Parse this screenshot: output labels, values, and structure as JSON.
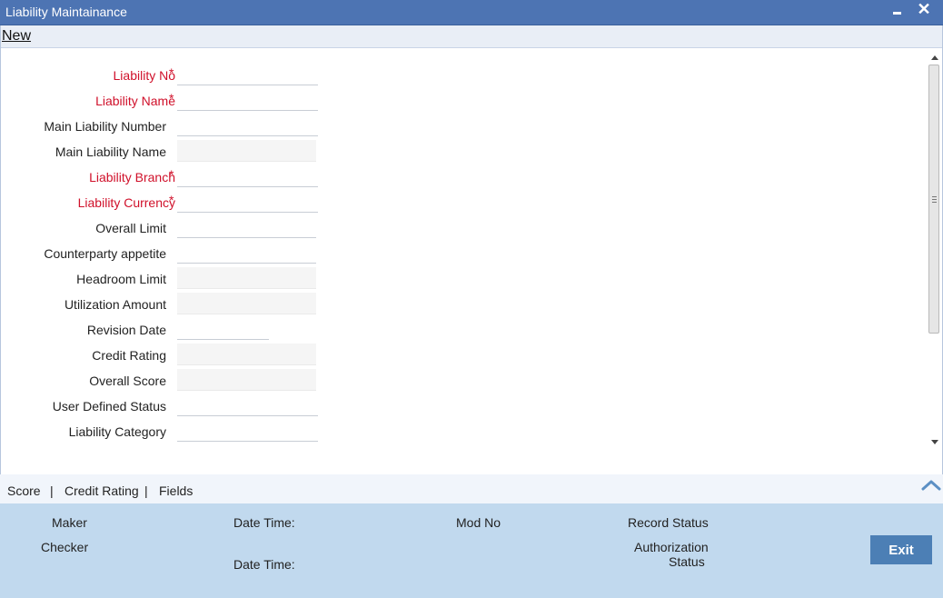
{
  "window": {
    "title": "Liability Maintainance",
    "minimize_icon": "minimize-icon",
    "close_icon": "close-icon",
    "close_glyph": "✕"
  },
  "toolbar": {
    "new_label": "New"
  },
  "form": {
    "fields": [
      {
        "label": "Liability No",
        "required": true,
        "value": "",
        "readonly": false
      },
      {
        "label": "Liability Name",
        "required": true,
        "value": "",
        "readonly": false
      },
      {
        "label": "Main Liability Number",
        "required": false,
        "value": "",
        "readonly": false
      },
      {
        "label": "Main Liability Name",
        "required": false,
        "value": "",
        "readonly": true
      },
      {
        "label": "Liability Branch",
        "required": true,
        "value": "",
        "readonly": false
      },
      {
        "label": "Liability Currency",
        "required": true,
        "value": "",
        "readonly": false
      },
      {
        "label": "Overall Limit",
        "required": false,
        "value": "",
        "readonly": false
      },
      {
        "label": "Counterparty appetite",
        "required": false,
        "value": "",
        "readonly": false
      },
      {
        "label": "Headroom Limit",
        "required": false,
        "value": "",
        "readonly": true
      },
      {
        "label": "Utilization Amount",
        "required": false,
        "value": "",
        "readonly": true
      },
      {
        "label": "Revision Date",
        "required": false,
        "value": "",
        "readonly": false
      },
      {
        "label": "Credit Rating",
        "required": false,
        "value": "",
        "readonly": true
      },
      {
        "label": "Overall Score",
        "required": false,
        "value": "",
        "readonly": true
      },
      {
        "label": "User Defined Status",
        "required": false,
        "value": "",
        "readonly": false
      },
      {
        "label": "Liability Category",
        "required": false,
        "value": "",
        "readonly": false
      }
    ],
    "required_marker": "*"
  },
  "tabs": [
    {
      "label": "Score"
    },
    {
      "label": "Credit Rating"
    },
    {
      "label": "Fields"
    }
  ],
  "tab_separator": "|",
  "footer": {
    "maker": "Maker",
    "checker": "Checker",
    "date_time_1": "Date Time:",
    "date_time_2": "Date Time:",
    "mod_no": "Mod No",
    "record_status": "Record Status",
    "authorization_status_line1": "Authorization",
    "authorization_status_line2": "Status",
    "exit_label": "Exit"
  },
  "colors": {
    "titlebar": "#4d74b3",
    "required_label": "#d0102a",
    "footer": "#c1d9ee",
    "exit_button": "#4c7fb5"
  }
}
